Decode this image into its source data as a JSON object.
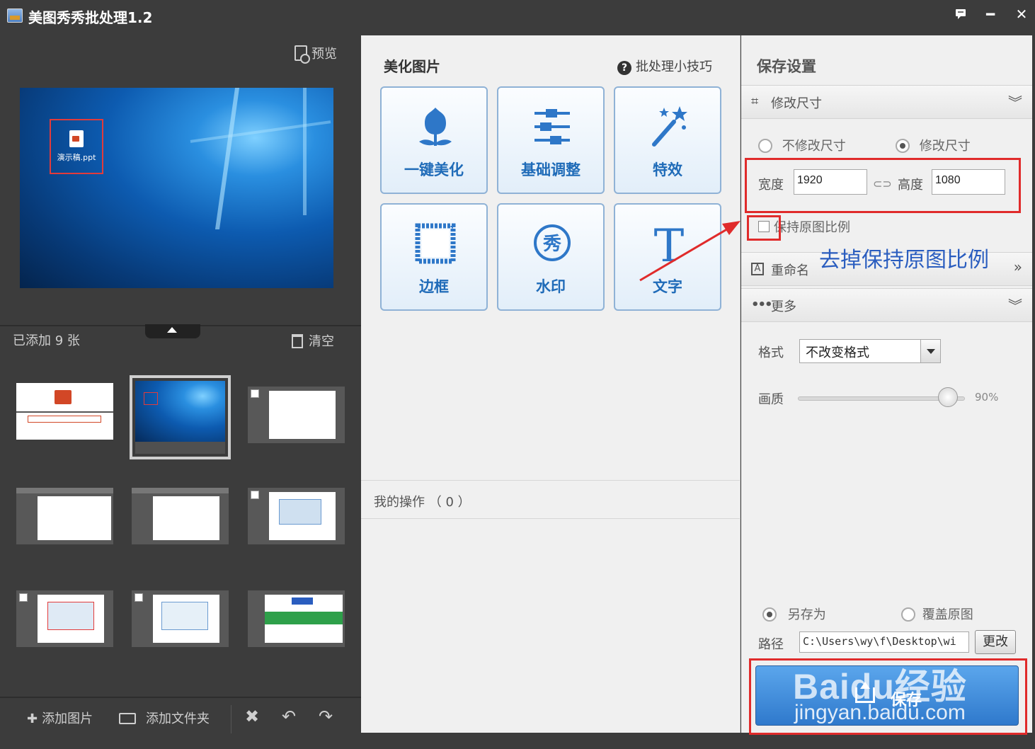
{
  "window": {
    "title": "美图秀秀批处理1.2",
    "buttons": [
      "message",
      "minimize",
      "close"
    ]
  },
  "left": {
    "preview_label": "预览",
    "preview_file_name": "演示稿.ppt",
    "added_count": "已添加 9 张",
    "clear_label": "清空",
    "thumbnail_count": 9,
    "selected_thumbnail": 2,
    "toolbar": {
      "add_images": "添加图片",
      "add_folder": "添加文件夹"
    }
  },
  "middle": {
    "title": "美化图片",
    "tips": "批处理小技巧",
    "tools": [
      {
        "label": "一键美化",
        "icon": "tulip-icon"
      },
      {
        "label": "基础调整",
        "icon": "sliders-icon"
      },
      {
        "label": "特效",
        "icon": "magic-wand-icon"
      },
      {
        "label": "边框",
        "icon": "frame-icon"
      },
      {
        "label": "水印",
        "icon": "watermark-icon"
      },
      {
        "label": "文字",
        "icon": "text-icon"
      }
    ],
    "my_operations": "我的操作 （ 0 ）"
  },
  "right": {
    "title": "保存设置",
    "resize_section": "修改尺寸",
    "no_resize": "不修改尺寸",
    "resize": "修改尺寸",
    "resize_selected": "修改尺寸",
    "width_label": "宽度",
    "width_value": "1920",
    "height_label": "高度",
    "height_value": "1080",
    "keep_ratio": "保持原图比例",
    "keep_ratio_checked": false,
    "annotation": "去掉保持原图比例",
    "rename_section": "重命名",
    "more_section": "更多",
    "format_label": "格式",
    "format_value": "不改变格式",
    "quality_label": "画质",
    "quality_value": "90%",
    "quality_fraction": 0.9,
    "save_as": "另存为",
    "overwrite": "覆盖原图",
    "save_mode_selected": "另存为",
    "path_label": "路径",
    "path_value": "C:\\Users\\wy\\f\\Desktop\\wi",
    "change_button": "更改",
    "save_button": "保存",
    "watermark_brand": "Baidu经验",
    "watermark_url": "jingyan.baidu.com"
  },
  "colors": {
    "accent_blue": "#1f6bb8",
    "highlight_red": "#e02b2b",
    "annotation_blue": "#2a5dbf"
  }
}
